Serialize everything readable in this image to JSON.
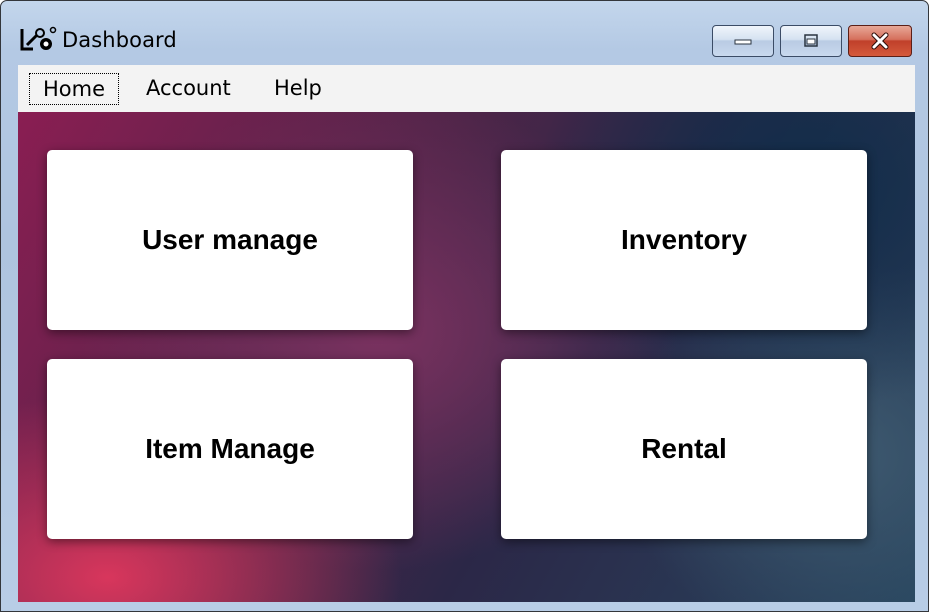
{
  "window": {
    "title": "Dashboard",
    "app_icon": "tools-icon",
    "controls": [
      "minimize-icon",
      "maximize-icon",
      "close-icon"
    ]
  },
  "menu": {
    "items": [
      {
        "label": "Home",
        "focused": true
      },
      {
        "label": "Account"
      },
      {
        "label": "Help"
      }
    ]
  },
  "tiles": [
    {
      "label": "User manage"
    },
    {
      "label": "Inventory"
    },
    {
      "label": "Item Manage"
    },
    {
      "label": "Rental"
    }
  ],
  "colors": {
    "tile_background": "#ffffff",
    "gradient_pink": "#d8365c",
    "gradient_navy": "#102d4a",
    "close_button": "#c0402a"
  }
}
